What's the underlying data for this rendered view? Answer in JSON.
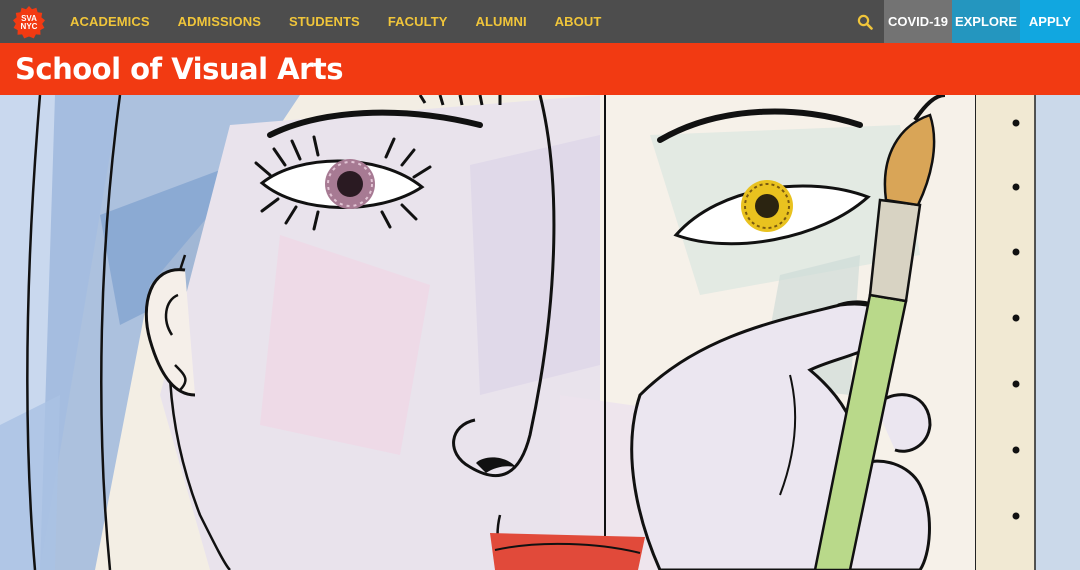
{
  "logo": {
    "line1": "SVA",
    "line2": "NYC"
  },
  "nav": {
    "items": [
      "ACADEMICS",
      "ADMISSIONS",
      "STUDENTS",
      "FACULTY",
      "ALUMNI",
      "ABOUT"
    ]
  },
  "utility": {
    "covid_label": "COVID-19",
    "explore_label": "EXPLORE",
    "apply_label": "APPLY"
  },
  "banner": {
    "title": "School of Visual Arts"
  },
  "colors": {
    "topbar": "#4d4d4d",
    "nav_text": "#f0c53a",
    "banner": "#f23a12",
    "covid_bg": "#737373",
    "explore_bg": "#2496bf",
    "apply_bg": "#11a7e0"
  },
  "icons": {
    "search": "search-icon",
    "logo": "sva-nyc-logo"
  }
}
